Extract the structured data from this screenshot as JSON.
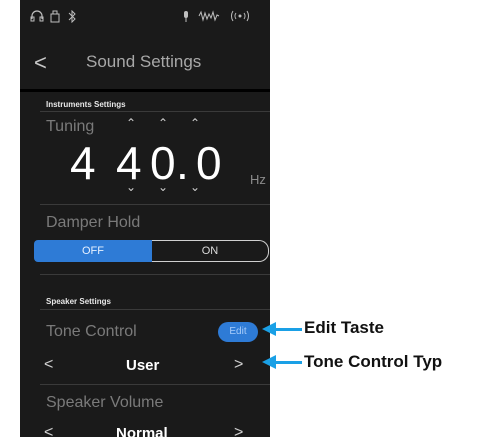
{
  "status_bar": {
    "headphones_icon": "headphones-icon",
    "usb_icon": "usb-icon",
    "bluetooth_icon": "bluetooth-icon",
    "mic_icon": "mic-icon",
    "waveform_icon": "waveform-icon",
    "wireless_icon": "wireless-icon"
  },
  "header": {
    "back_label": "<",
    "title": "Sound Settings"
  },
  "instruments_settings": {
    "section_label": "Instruments Settings",
    "tuning": {
      "label": "Tuning",
      "digits": [
        "4",
        "4",
        "0",
        ".",
        "0"
      ],
      "unit": "Hz"
    },
    "damper_hold": {
      "label": "Damper Hold",
      "off_label": "OFF",
      "on_label": "ON",
      "selected": "OFF"
    }
  },
  "speaker_settings": {
    "section_label": "Speaker Settings",
    "tone_control": {
      "label": "Tone Control",
      "edit_label": "Edit",
      "prev_label": "<",
      "next_label": ">",
      "value": "User"
    },
    "speaker_volume": {
      "label": "Speaker Volume",
      "prev_label": "<",
      "next_label": ">",
      "value": "Normal"
    }
  },
  "callouts": {
    "edit": "Edit Taste",
    "type": "Tone Control Typ"
  },
  "colors": {
    "accent": "#2e7bd6",
    "callout": "#1aa0e6",
    "background": "#1a1a1a"
  }
}
